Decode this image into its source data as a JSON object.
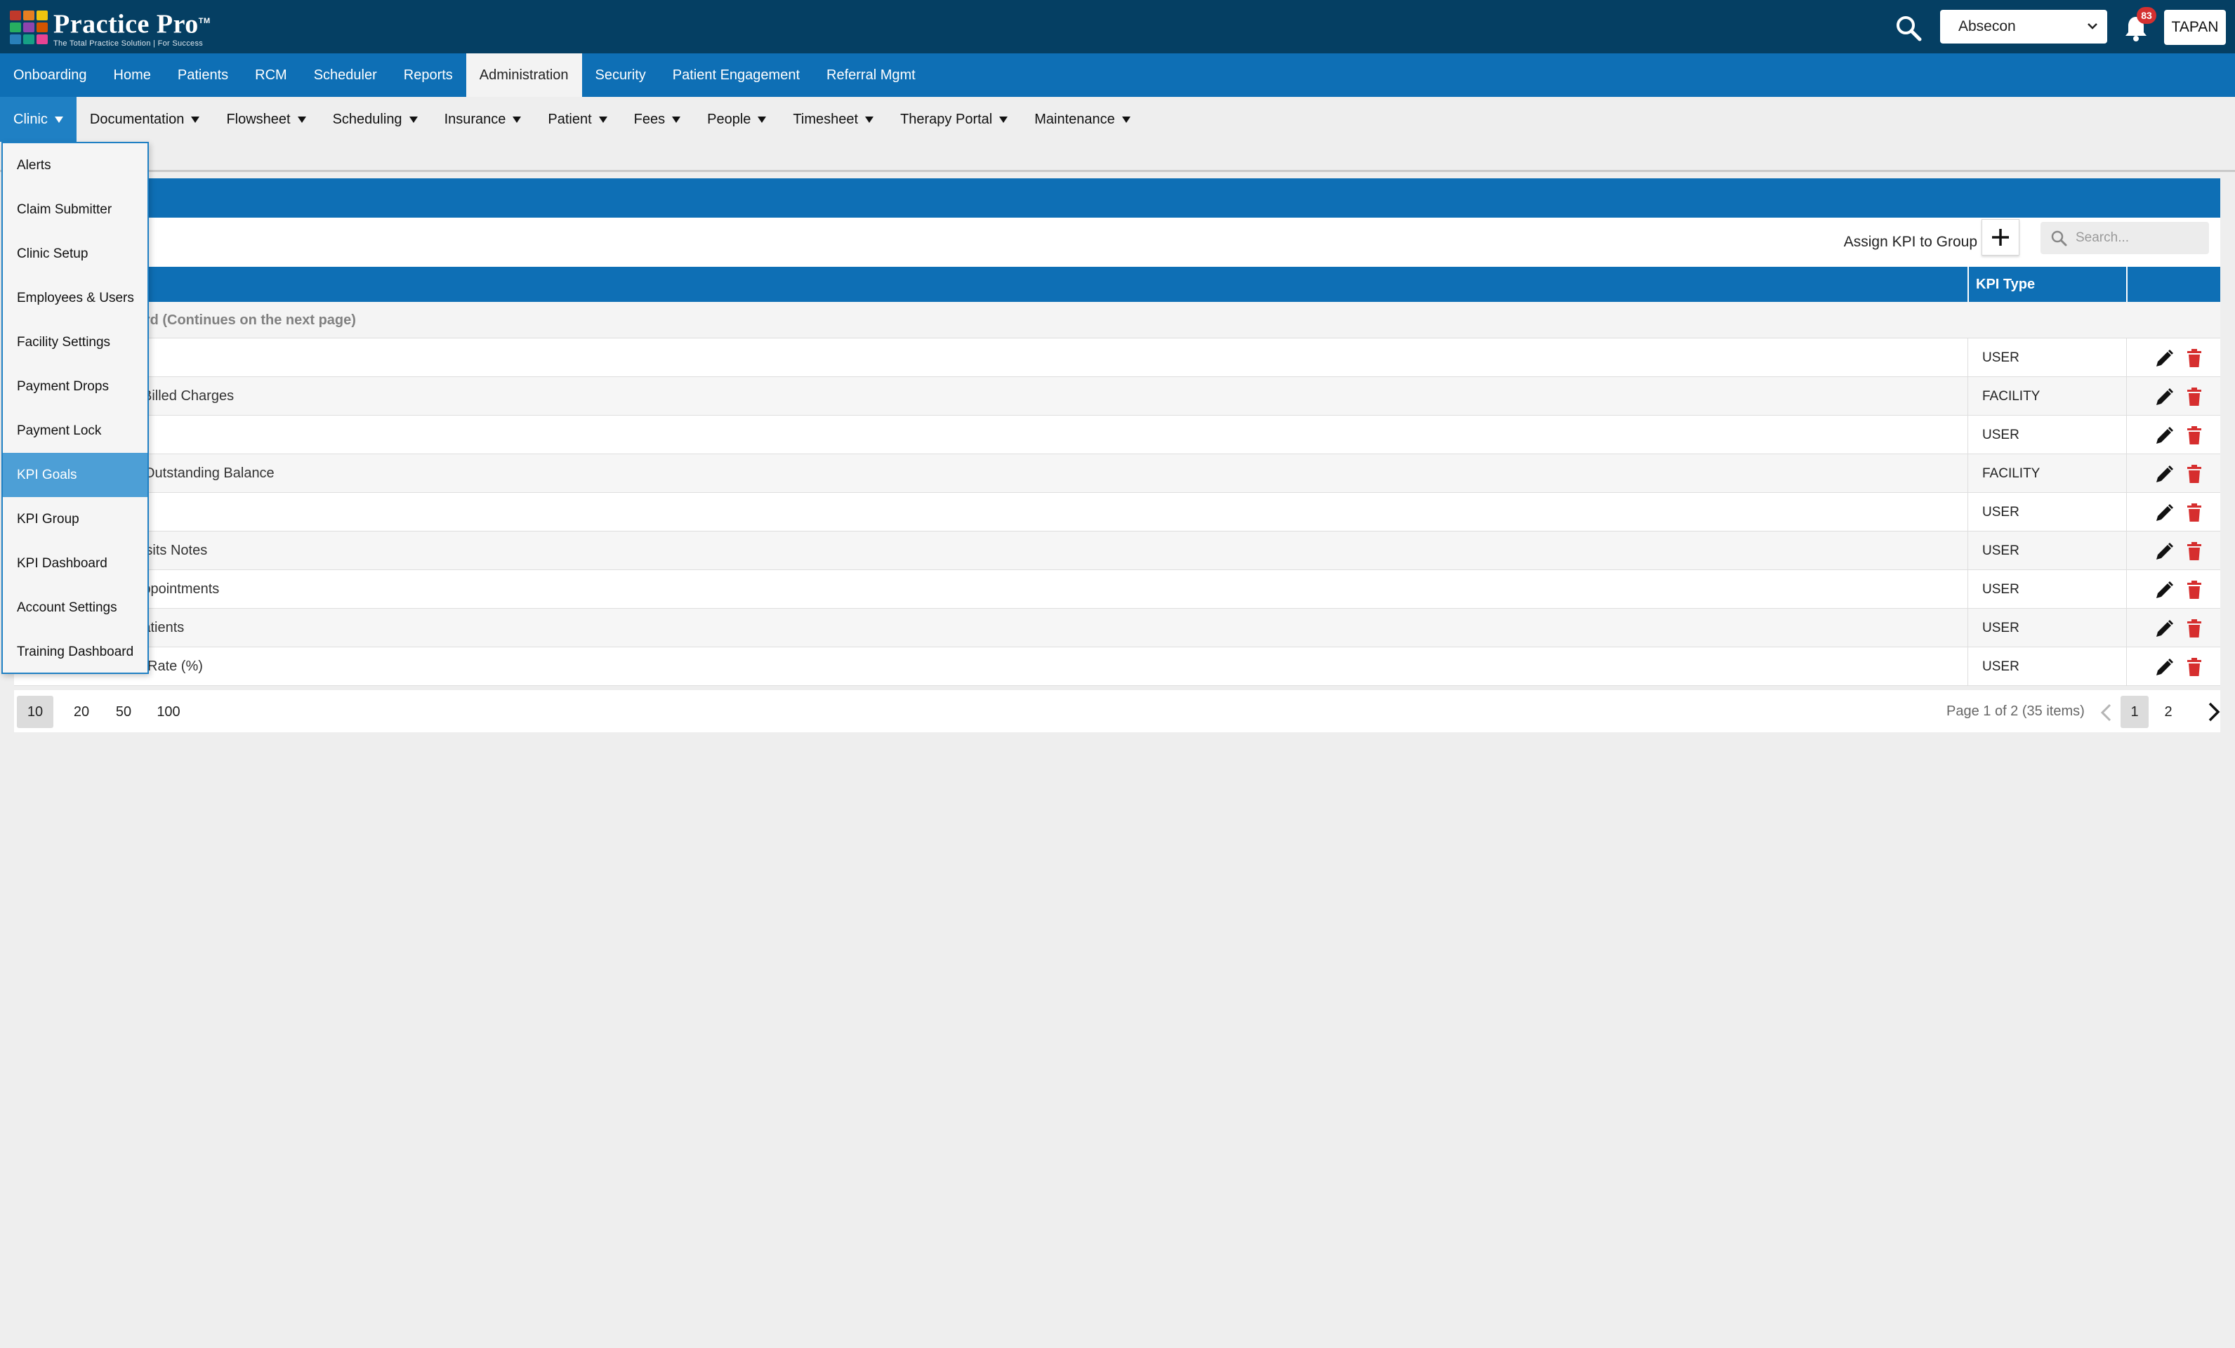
{
  "app": {
    "logo_title": "Practice Pro",
    "logo_tm": "TM",
    "logo_subtitle": "The Total Practice Solution | For Success",
    "facility": "Absecon",
    "notification_count": "83",
    "user": "TAPAN"
  },
  "main_nav": [
    {
      "label": "Onboarding",
      "active": false
    },
    {
      "label": "Home",
      "active": false
    },
    {
      "label": "Patients",
      "active": false
    },
    {
      "label": "RCM",
      "active": false
    },
    {
      "label": "Scheduler",
      "active": false
    },
    {
      "label": "Reports",
      "active": false
    },
    {
      "label": "Administration",
      "active": true
    },
    {
      "label": "Security",
      "active": false
    },
    {
      "label": "Patient Engagement",
      "active": false
    },
    {
      "label": "Referral Mgmt",
      "active": false
    }
  ],
  "sub_nav": [
    {
      "label": "Clinic",
      "active": true
    },
    {
      "label": "Documentation",
      "active": false
    },
    {
      "label": "Flowsheet",
      "active": false
    },
    {
      "label": "Scheduling",
      "active": false
    },
    {
      "label": "Insurance",
      "active": false
    },
    {
      "label": "Patient",
      "active": false
    },
    {
      "label": "Fees",
      "active": false
    },
    {
      "label": "People",
      "active": false
    },
    {
      "label": "Timesheet",
      "active": false
    },
    {
      "label": "Therapy Portal",
      "active": false
    },
    {
      "label": "Maintenance",
      "active": false
    }
  ],
  "clinic_menu": [
    {
      "label": "Alerts",
      "active": false
    },
    {
      "label": "Claim Submitter",
      "active": false
    },
    {
      "label": "Clinic Setup",
      "active": false
    },
    {
      "label": "Employees & Users",
      "active": false
    },
    {
      "label": "Facility Settings",
      "active": false
    },
    {
      "label": "Payment Drops",
      "active": false
    },
    {
      "label": "Payment Lock",
      "active": false
    },
    {
      "label": "KPI Goals",
      "active": true
    },
    {
      "label": "KPI Group",
      "active": false
    },
    {
      "label": "KPI Dashboard",
      "active": false
    },
    {
      "label": "Account Settings",
      "active": false
    },
    {
      "label": "Training Dashboard",
      "active": false
    }
  ],
  "toolbar": {
    "assign_label": "Assign KPI to Group",
    "search_placeholder": "Search..."
  },
  "table": {
    "kpi_type_header": "KPI Type",
    "group_label": "Training Dashboard (Continues on the next page)",
    "rows": [
      {
        "name": "",
        "type": "USER"
      },
      {
        "name": "Billed Charges",
        "type": "FACILITY"
      },
      {
        "name": "",
        "type": "USER"
      },
      {
        "name": "Outstanding Balance",
        "type": "FACILITY"
      },
      {
        "name": "",
        "type": "USER"
      },
      {
        "name": "Visits Notes",
        "type": "USER"
      },
      {
        "name": "Appointments",
        "type": "USER"
      },
      {
        "name": "Patients",
        "type": "USER"
      },
      {
        "name": "Rate (%)",
        "type": "USER"
      }
    ]
  },
  "pager": {
    "sizes": [
      {
        "label": "10",
        "active": true
      },
      {
        "label": "20",
        "active": false
      },
      {
        "label": "50",
        "active": false
      },
      {
        "label": "100",
        "active": false
      }
    ],
    "info": "Page 1 of 2 (35 items)",
    "pages": [
      {
        "label": "1",
        "active": true
      },
      {
        "label": "2",
        "active": false
      }
    ]
  },
  "colors": {
    "topbar": "#053f63",
    "nav": "#0e6fb5",
    "accent": "#1f80c4",
    "delete": "#d62e2e"
  }
}
